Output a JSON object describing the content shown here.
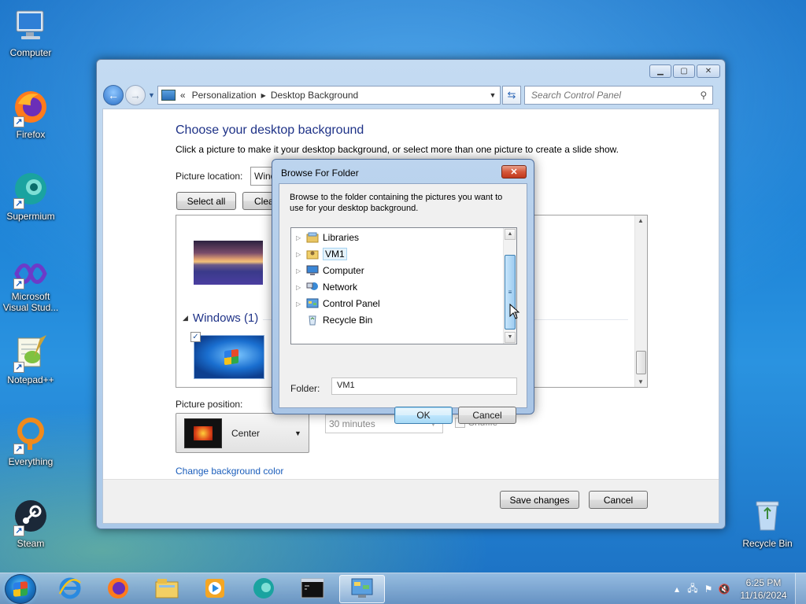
{
  "desktop": {
    "icons": [
      {
        "label": "Computer"
      },
      {
        "label": "Firefox"
      },
      {
        "label": "Supermium"
      },
      {
        "label": "Microsoft Visual Stud..."
      },
      {
        "label": "Notepad++"
      },
      {
        "label": "Everything"
      },
      {
        "label": "Steam"
      },
      {
        "label": "Recycle Bin"
      }
    ]
  },
  "window": {
    "breadcrumb": [
      "Personalization",
      "Desktop Background"
    ],
    "breadcrumb_prefix": "«",
    "search_placeholder": "Search Control Panel",
    "heading": "Choose your desktop background",
    "subtext": "Click a picture to make it your desktop background, or select more than one picture to create a slide show.",
    "picture_location_label": "Picture location:",
    "picture_location_value": "Windows Desktop Backgrounds",
    "select_all": "Select all",
    "clear_all": "Clear all",
    "group_windows": "Windows (1)",
    "picture_position_label": "Picture position:",
    "picture_position_value": "Center",
    "interval_value": "30 minutes",
    "shuffle_label": "Shuffle",
    "change_color_link": "Change background color",
    "save_changes": "Save changes",
    "cancel": "Cancel"
  },
  "dialog": {
    "title": "Browse For Folder",
    "close_glyph": "✕",
    "description": "Browse to the folder containing the pictures you want to use for your desktop background.",
    "tree": [
      {
        "label": "Libraries",
        "icon": "library-icon",
        "expandable": true
      },
      {
        "label": "VM1",
        "icon": "user-folder-icon",
        "expandable": true,
        "selected": true
      },
      {
        "label": "Computer",
        "icon": "computer-icon",
        "expandable": true
      },
      {
        "label": "Network",
        "icon": "network-icon",
        "expandable": true
      },
      {
        "label": "Control Panel",
        "icon": "control-panel-icon",
        "expandable": true
      },
      {
        "label": "Recycle Bin",
        "icon": "recycle-bin-icon",
        "expandable": false
      }
    ],
    "folder_label": "Folder:",
    "folder_value": "VM1",
    "ok": "OK",
    "cancel": "Cancel"
  },
  "taskbar": {
    "clock_time": "6:25 PM",
    "clock_date": "11/16/2024"
  }
}
